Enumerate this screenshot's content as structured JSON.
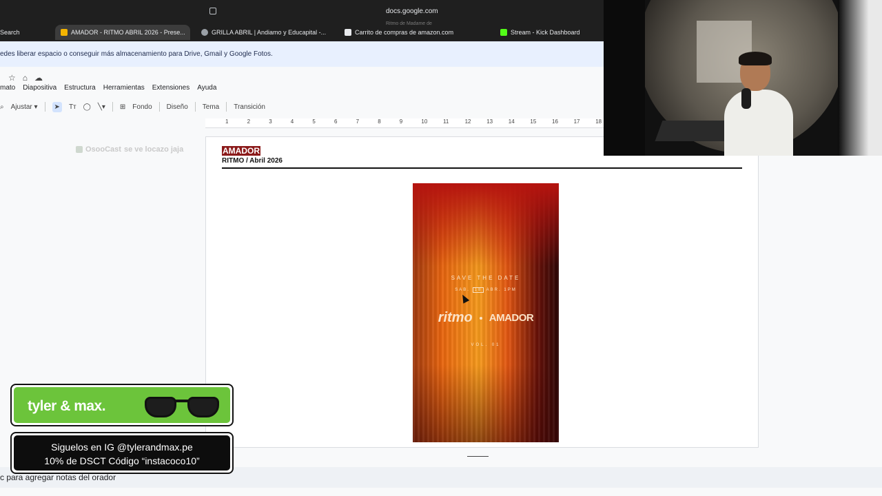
{
  "browser": {
    "address": "docs.google.com",
    "tabs": [
      {
        "label": "Search",
        "active": false
      },
      {
        "label": "AMADOR - RITMO ABRIL 2026 - Prese...",
        "active": true
      },
      {
        "label": "GRILLA ABRIL | Andiamo y Educapital -...",
        "active": false
      },
      {
        "label": "Carrito de compras de amazon.com",
        "active": false
      },
      {
        "label": "Stream - Kick Dashboard",
        "active": false
      }
    ],
    "tooltip": "Ritmo de Madame de"
  },
  "banner": {
    "text": "edes liberar espacio o conseguir más almacenamiento para Drive, Gmail y Google Fotos."
  },
  "menu": [
    "mato",
    "Diapositiva",
    "Estructura",
    "Herramientas",
    "Extensiones",
    "Ayuda"
  ],
  "toolbar": {
    "zoom_label": "Ajustar",
    "text_tool": "Tт",
    "fondo": "Fondo",
    "diseno": "Diseño",
    "tema": "Tema",
    "transicion": "Transición"
  },
  "ruler": [
    "1",
    "2",
    "3",
    "4",
    "5",
    "6",
    "7",
    "8",
    "9",
    "10",
    "11",
    "12",
    "13",
    "14",
    "15",
    "16",
    "17",
    "18"
  ],
  "comment_tag": {
    "user": "OsooCast",
    "text": "se ve locazo jaja"
  },
  "slide": {
    "title": "AMADOR",
    "subtitle": "RITMO / Abril 2026",
    "poster": {
      "save": "SAVE THE DATE",
      "date_day_name": "SAB.",
      "date_day": "18",
      "date_month": "ABR.",
      "date_time": "1PM",
      "brand1": "ritmo",
      "brand2": "AMADOR",
      "vol": "VOL. 01"
    }
  },
  "notes": {
    "placeholder": "c para agregar notas del orador"
  },
  "sponsor": {
    "brand": "tyler & max.",
    "line1": "Siguelos en IG @tylerandmax.pe",
    "line2": "10% de DSCT Código “instacoco10”"
  },
  "colors": {
    "accent": "#8b1a1a",
    "banner": "#e8f0fe",
    "sponsor_green": "#6cc43b"
  }
}
